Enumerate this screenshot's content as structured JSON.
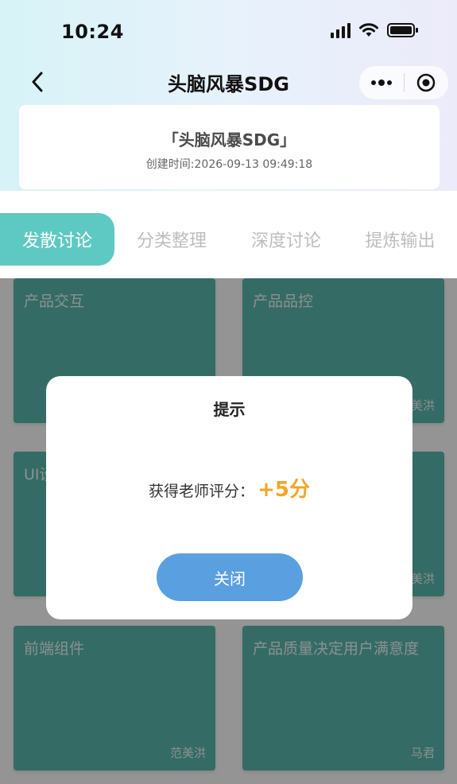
{
  "status_bar": {
    "time": "10:24",
    "signal_icon": "signal-icon",
    "wifi_icon": "wifi-icon",
    "battery_icon": "battery-icon"
  },
  "nav": {
    "back_icon": "chevron-left-icon",
    "title": "头脑风暴SDG",
    "more_icon": "more-dots-icon",
    "close_icon": "target-circle-icon"
  },
  "session": {
    "title": "「头脑风暴SDG」",
    "created": "创建时间:2026-09-13 09:49:18"
  },
  "tabs": [
    {
      "label": "发散讨论",
      "active": true
    },
    {
      "label": "分类整理",
      "active": false
    },
    {
      "label": "深度讨论",
      "active": false
    },
    {
      "label": "提炼输出",
      "active": false
    }
  ],
  "cards": [
    {
      "title": "产品交互",
      "author": ""
    },
    {
      "title": "产品品控",
      "author": "美洪"
    },
    {
      "title": "UI设",
      "author": ""
    },
    {
      "title": "",
      "author": "美洪"
    },
    {
      "title": "前端组件",
      "author": "范美洪"
    },
    {
      "title": "产品质量决定用户满意度",
      "author": "马君"
    }
  ],
  "modal": {
    "title": "提示",
    "label": "获得老师评分：",
    "score": "+5分",
    "close_label": "关闭"
  },
  "colors": {
    "accent_tab": "#5ec9c2",
    "card": "#5ab8af",
    "score": "#f2a624",
    "button": "#5aa0e0"
  }
}
